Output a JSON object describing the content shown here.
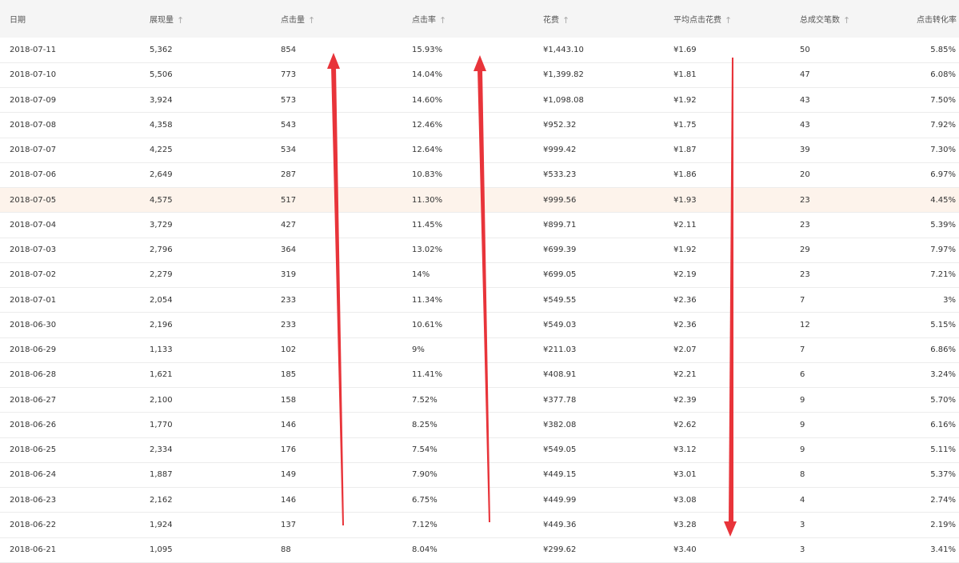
{
  "table": {
    "columns": [
      {
        "label": "日期",
        "sortable": false
      },
      {
        "label": "展现量",
        "sortable": true
      },
      {
        "label": "点击量",
        "sortable": true
      },
      {
        "label": "点击率",
        "sortable": true
      },
      {
        "label": "花费",
        "sortable": true
      },
      {
        "label": "平均点击花费",
        "sortable": true
      },
      {
        "label": "总成交笔数",
        "sortable": true
      },
      {
        "label": "点击转化率",
        "sortable": false
      }
    ],
    "sort_icon": "arrow-up-icon",
    "highlighted_row": 6,
    "rows": [
      [
        "2018-07-11",
        "5,362",
        "854",
        "15.93%",
        "¥1,443.10",
        "¥1.69",
        "50",
        "5.85%"
      ],
      [
        "2018-07-10",
        "5,506",
        "773",
        "14.04%",
        "¥1,399.82",
        "¥1.81",
        "47",
        "6.08%"
      ],
      [
        "2018-07-09",
        "3,924",
        "573",
        "14.60%",
        "¥1,098.08",
        "¥1.92",
        "43",
        "7.50%"
      ],
      [
        "2018-07-08",
        "4,358",
        "543",
        "12.46%",
        "¥952.32",
        "¥1.75",
        "43",
        "7.92%"
      ],
      [
        "2018-07-07",
        "4,225",
        "534",
        "12.64%",
        "¥999.42",
        "¥1.87",
        "39",
        "7.30%"
      ],
      [
        "2018-07-06",
        "2,649",
        "287",
        "10.83%",
        "¥533.23",
        "¥1.86",
        "20",
        "6.97%"
      ],
      [
        "2018-07-05",
        "4,575",
        "517",
        "11.30%",
        "¥999.56",
        "¥1.93",
        "23",
        "4.45%"
      ],
      [
        "2018-07-04",
        "3,729",
        "427",
        "11.45%",
        "¥899.71",
        "¥2.11",
        "23",
        "5.39%"
      ],
      [
        "2018-07-03",
        "2,796",
        "364",
        "13.02%",
        "¥699.39",
        "¥1.92",
        "29",
        "7.97%"
      ],
      [
        "2018-07-02",
        "2,279",
        "319",
        "14%",
        "¥699.05",
        "¥2.19",
        "23",
        "7.21%"
      ],
      [
        "2018-07-01",
        "2,054",
        "233",
        "11.34%",
        "¥549.55",
        "¥2.36",
        "7",
        "3%"
      ],
      [
        "2018-06-30",
        "2,196",
        "233",
        "10.61%",
        "¥549.03",
        "¥2.36",
        "12",
        "5.15%"
      ],
      [
        "2018-06-29",
        "1,133",
        "102",
        "9%",
        "¥211.03",
        "¥2.07",
        "7",
        "6.86%"
      ],
      [
        "2018-06-28",
        "1,621",
        "185",
        "11.41%",
        "¥408.91",
        "¥2.21",
        "6",
        "3.24%"
      ],
      [
        "2018-06-27",
        "2,100",
        "158",
        "7.52%",
        "¥377.78",
        "¥2.39",
        "9",
        "5.70%"
      ],
      [
        "2018-06-26",
        "1,770",
        "146",
        "8.25%",
        "¥382.08",
        "¥2.62",
        "9",
        "6.16%"
      ],
      [
        "2018-06-25",
        "2,334",
        "176",
        "7.54%",
        "¥549.05",
        "¥3.12",
        "9",
        "5.11%"
      ],
      [
        "2018-06-24",
        "1,887",
        "149",
        "7.90%",
        "¥449.15",
        "¥3.01",
        "8",
        "5.37%"
      ],
      [
        "2018-06-23",
        "2,162",
        "146",
        "6.75%",
        "¥449.99",
        "¥3.08",
        "4",
        "2.74%"
      ],
      [
        "2018-06-22",
        "1,924",
        "137",
        "7.12%",
        "¥449.36",
        "¥3.28",
        "3",
        "2.19%"
      ],
      [
        "2018-06-21",
        "1,095",
        "88",
        "8.04%",
        "¥299.62",
        "¥3.40",
        "3",
        "3.41%"
      ]
    ]
  },
  "colors": {
    "header_bg": "#f5f5f5",
    "highlight_row_bg": "#fdf3eb",
    "annotation_arrow": "#e8343a",
    "row_divider": "#ececec"
  },
  "annotations": [
    {
      "name": "click-volume-up-arrow-icon",
      "direction": "up"
    },
    {
      "name": "click-rate-up-arrow-icon",
      "direction": "up"
    },
    {
      "name": "avg-click-cost-down-arrow-icon",
      "direction": "down"
    }
  ]
}
